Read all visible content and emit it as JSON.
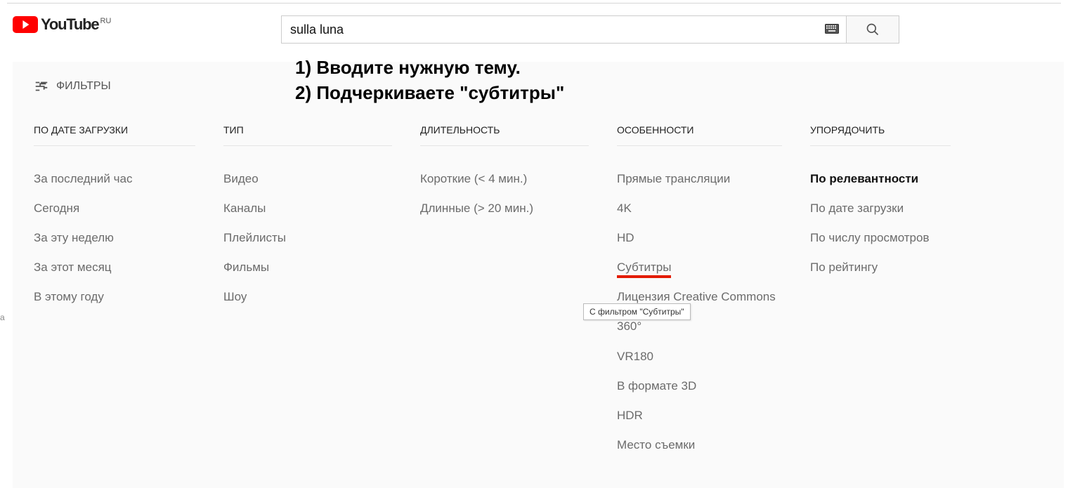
{
  "logo": {
    "text": "YouTube",
    "region": "RU"
  },
  "search": {
    "value": "sulla luna"
  },
  "annotations": {
    "line1": "1) Вводите нужную тему.",
    "line2": "2) Подчеркиваете \"субтитры\""
  },
  "filters_button": "ФИЛЬТРЫ",
  "filters": {
    "columns": [
      {
        "title": "ПО ДАТЕ ЗАГРУЗКИ",
        "items": [
          {
            "label": "За последний час"
          },
          {
            "label": "Сегодня"
          },
          {
            "label": "За эту неделю"
          },
          {
            "label": "За этот месяц"
          },
          {
            "label": "В этому году"
          }
        ]
      },
      {
        "title": "ТИП",
        "items": [
          {
            "label": "Видео"
          },
          {
            "label": "Каналы"
          },
          {
            "label": "Плейлисты"
          },
          {
            "label": "Фильмы"
          },
          {
            "label": "Шоу"
          }
        ]
      },
      {
        "title": "ДЛИТЕЛЬНОСТЬ",
        "items": [
          {
            "label": "Короткие (< 4 мин.)"
          },
          {
            "label": "Длинные (> 20 мин.)"
          }
        ]
      },
      {
        "title": "ОСОБЕННОСТИ",
        "items": [
          {
            "label": "Прямые трансляции"
          },
          {
            "label": "4K"
          },
          {
            "label": "HD"
          },
          {
            "label": "Субтитры",
            "highlight": true
          },
          {
            "label": "Лицензия Creative Commons"
          },
          {
            "label": "360°"
          },
          {
            "label": "VR180"
          },
          {
            "label": "В формате 3D"
          },
          {
            "label": "HDR"
          },
          {
            "label": "Место съемки"
          }
        ]
      },
      {
        "title": "УПОРЯДОЧИТЬ",
        "items": [
          {
            "label": "По релевантности",
            "bold": true
          },
          {
            "label": "По дате загрузки"
          },
          {
            "label": "По числу просмотров"
          },
          {
            "label": "По рейтингу"
          }
        ]
      }
    ]
  },
  "tooltip": "С фильтром \"Субтитры\"",
  "left_edge_char": "a"
}
